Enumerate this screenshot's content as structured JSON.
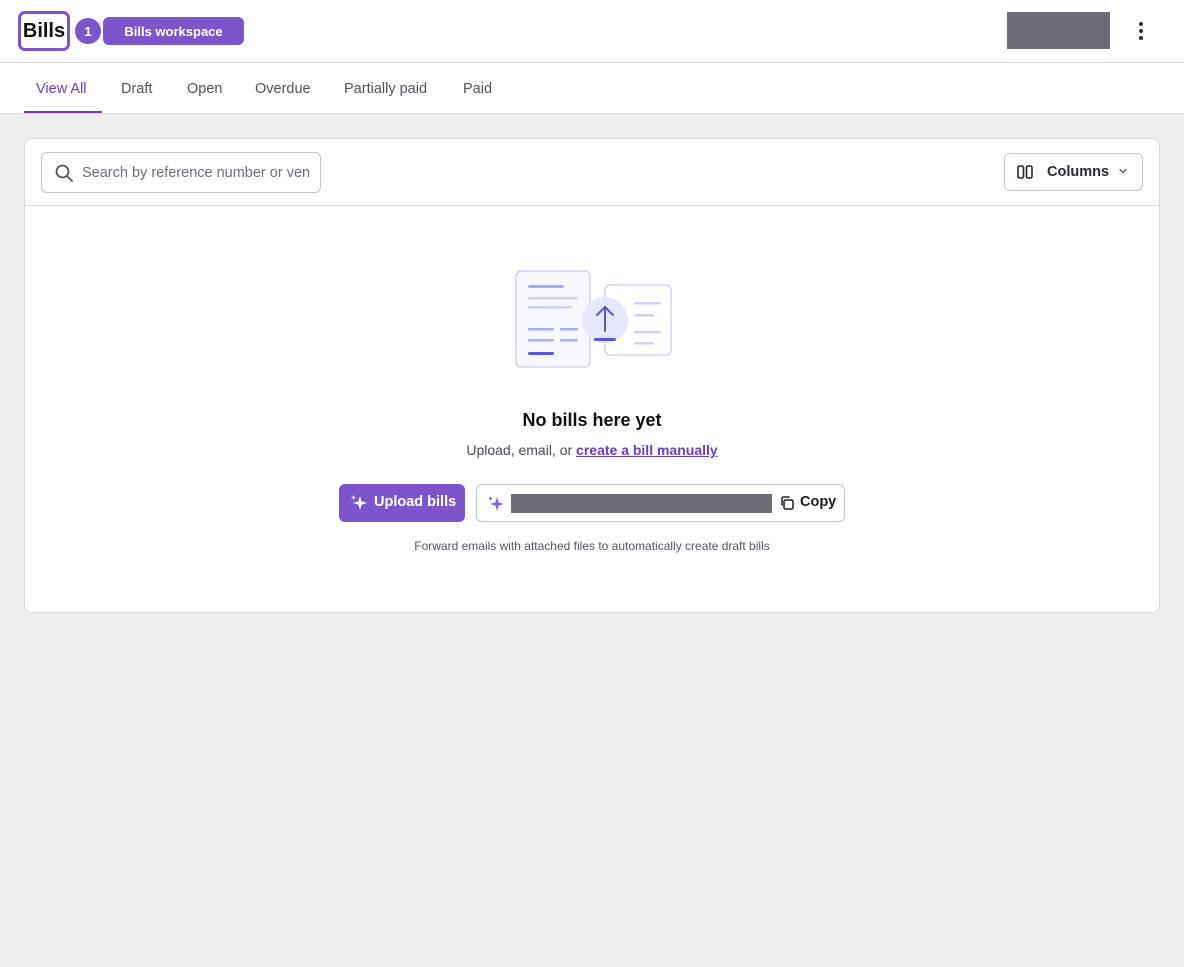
{
  "header": {
    "title": "Bills",
    "count": "1",
    "workspace_badge": "Bills workspace",
    "more_icon": "kebab-vertical-icon"
  },
  "tabs": [
    {
      "label": "View All",
      "active": true
    },
    {
      "label": "Draft",
      "active": false
    },
    {
      "label": "Open",
      "active": false
    },
    {
      "label": "Overdue",
      "active": false
    },
    {
      "label": "Partially paid",
      "active": false
    },
    {
      "label": "Paid",
      "active": false
    }
  ],
  "toolbar": {
    "search_placeholder": "Search by reference number or vendor",
    "search_icon": "search-icon",
    "columns_label": "Columns",
    "columns_icon": "columns-icon"
  },
  "empty_state": {
    "title": "No bills here yet",
    "subtitle_prefix": "Upload, email, or ",
    "subtitle_link": "create a bill manually",
    "upload_label": "Upload bills",
    "copy_label": "Copy",
    "hint": "Forward emails with attached files to automatically create draft bills"
  },
  "colors": {
    "brand": "#7b55c9",
    "active_tab": "#6a3fc4",
    "background": "#eeeeee"
  }
}
